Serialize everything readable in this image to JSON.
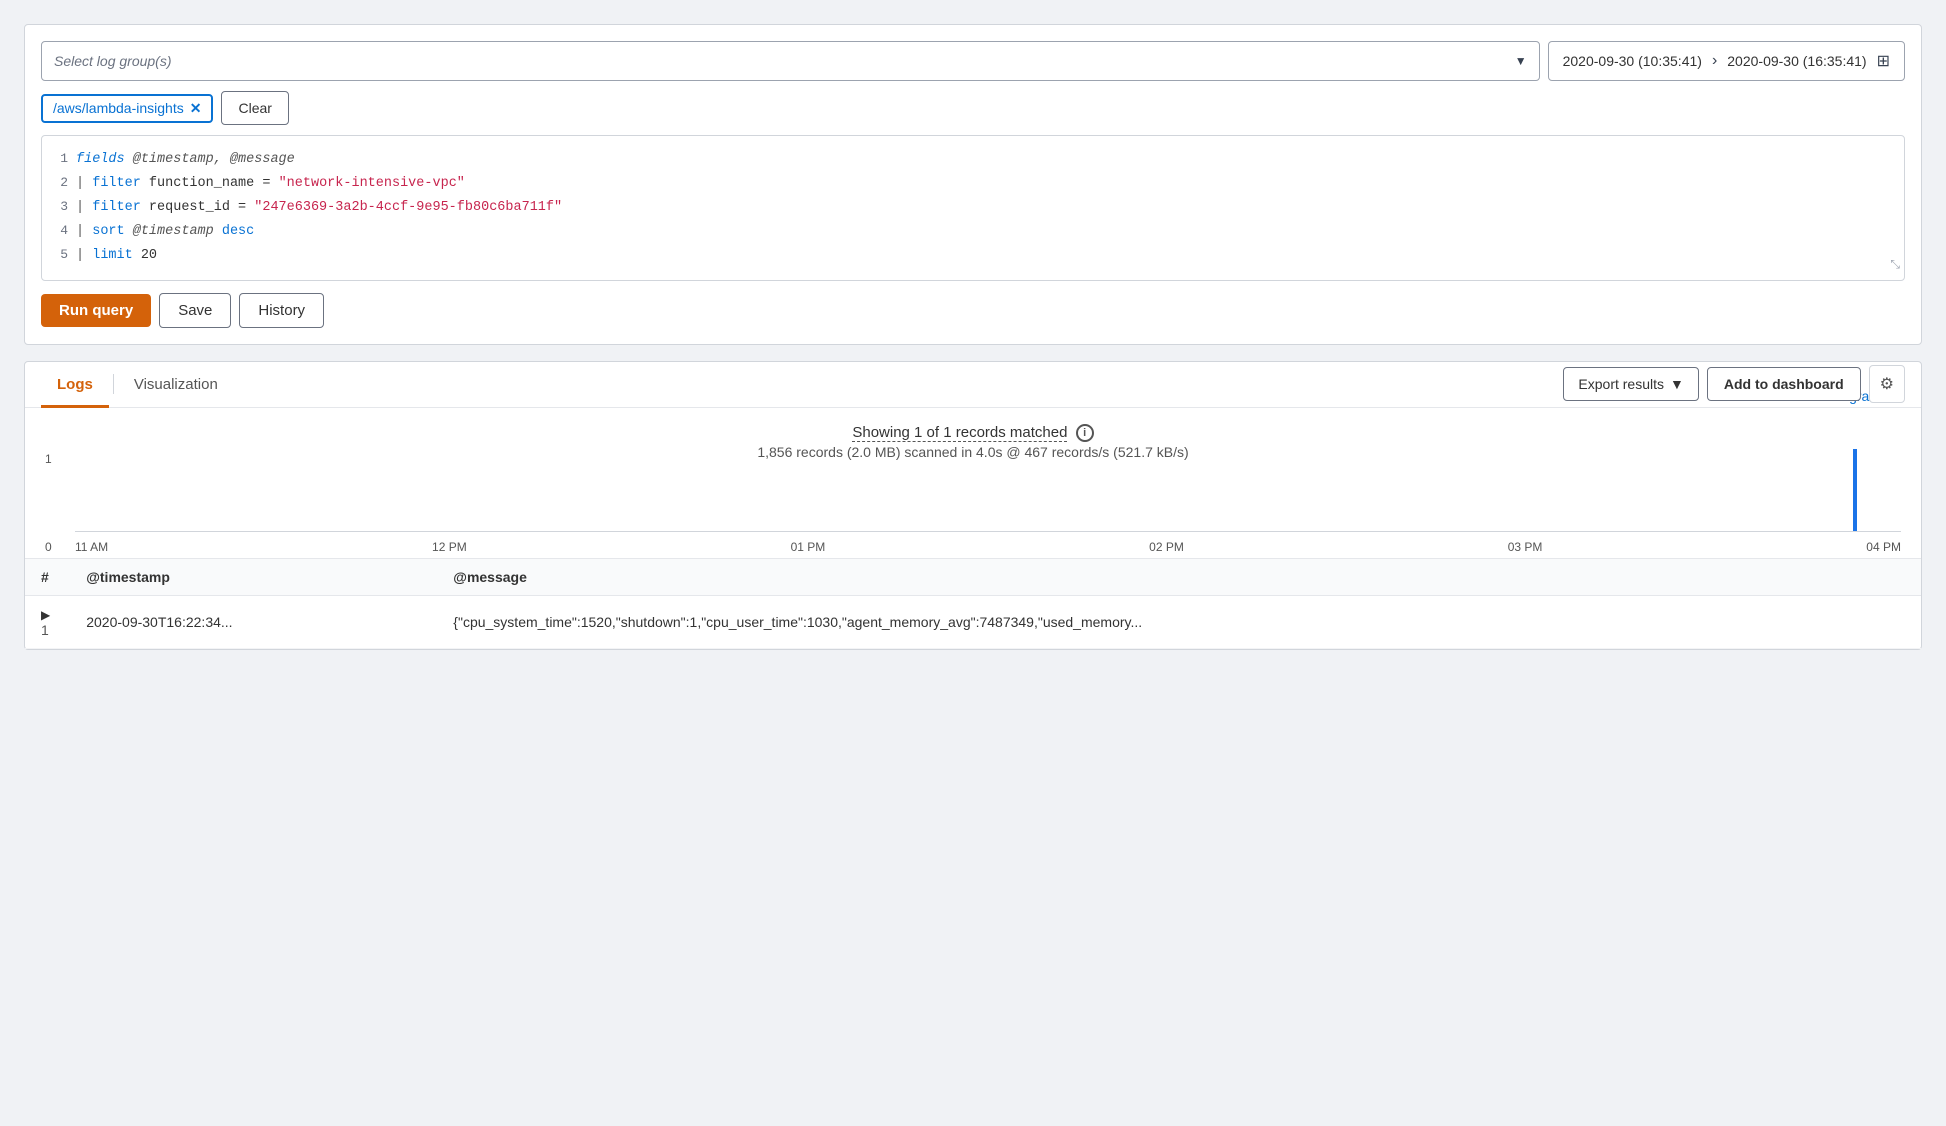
{
  "top_panel": {
    "log_group_placeholder": "Select log group(s)",
    "date_start": "2020-09-30 (10:35:41)",
    "date_end": "2020-09-30 (16:35:41)",
    "selected_log_group": "/aws/lambda-insights",
    "clear_label": "Clear",
    "code_lines": [
      {
        "num": "1",
        "content_html": "<span class='kw-fields'>fields</span> <span class='kw-at'>@timestamp, @message</span>"
      },
      {
        "num": "2",
        "content_html": "<span class='kw-pipe'>|</span> <span class='kw-filter'>filter</span> function_name = <span class='kw-string'>\"network-intensive-vpc\"</span>"
      },
      {
        "num": "3",
        "content_html": "<span class='kw-pipe'>|</span> <span class='kw-filter'>filter</span> request_id = <span class='kw-string'>\"247e6369-3a2b-4ccf-9e95-fb80c6ba711f\"</span>"
      },
      {
        "num": "4",
        "content_html": "<span class='kw-pipe'>|</span> <span class='kw-sort'>sort</span> <span class='kw-at'>@timestamp</span> <span class='kw-desc'>desc</span>"
      },
      {
        "num": "5",
        "content_html": "<span class='kw-pipe'>|</span> <span class='kw-limit'>limit</span> 20"
      }
    ],
    "run_query_label": "Run query",
    "save_label": "Save",
    "history_label": "History"
  },
  "bottom_panel": {
    "tabs": [
      "Logs",
      "Visualization"
    ],
    "active_tab": "Logs",
    "export_results_label": "Export results",
    "add_dashboard_label": "Add to dashboard",
    "results_summary": "Showing 1 of 1 records matched",
    "results_sub": "1,856 records (2.0 MB) scanned in 4.0s @ 467 records/s (521.7 kB/s)",
    "hide_histogram_label": "Hide histogram",
    "histogram": {
      "y_labels": [
        "1",
        "0"
      ],
      "x_labels": [
        "11 AM",
        "12 PM",
        "01 PM",
        "02 PM",
        "03 PM",
        "04 PM"
      ],
      "bar_position_pct": 94,
      "bar_height_pct": 100
    },
    "table": {
      "headers": [
        "#",
        "@timestamp",
        "@message"
      ],
      "rows": [
        {
          "num": "1",
          "timestamp": "2020-09-30T16:22:34...",
          "message": "{\"cpu_system_time\":1520,\"shutdown\":1,\"cpu_user_time\":1030,\"agent_memory_avg\":7487349,\"used_memory..."
        }
      ]
    }
  }
}
